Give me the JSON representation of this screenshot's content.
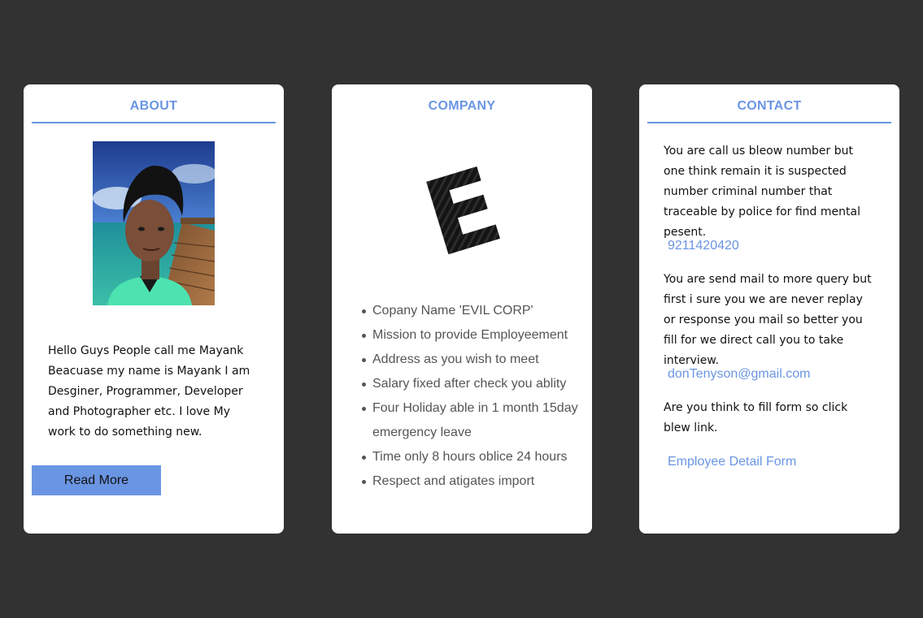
{
  "about": {
    "title": "ABOUT",
    "bio": "Hello Guys People call me Mayank Beacuase my name is Mayank I am Desginer, Programmer, Developer and Photographer etc. I love My work to do something new.",
    "read_more_label": "Read More"
  },
  "company": {
    "title": "COMPANY",
    "logo_letter": "E",
    "items": [
      "Copany Name 'EVIL CORP'",
      "Mission to provide Employeement",
      "Address as you wish to meet",
      "Salary fixed after check you ablity",
      "Four Holiday able in 1 month 15day emergency leave",
      "Time only 8 hours oblice 24 hours",
      "Respect and atigates import"
    ]
  },
  "contact": {
    "title": "CONTACT",
    "phone_text": "You are call us bleow number but one think remain it is suspected number criminal number that traceable by police for find mental pesent.",
    "phone": "9211420420",
    "mail_text": "You are send mail to more query but first i sure you we are never replay or response you mail so better you fill for we direct call you to take interview.",
    "email": "donTenyson@gmail.com",
    "form_text": "Are you think to fill form so click blew link.",
    "form_link": "Employee Detail Form"
  },
  "colors": {
    "background": "#323232",
    "accent": "#6a95e3",
    "card": "#ffffff"
  }
}
